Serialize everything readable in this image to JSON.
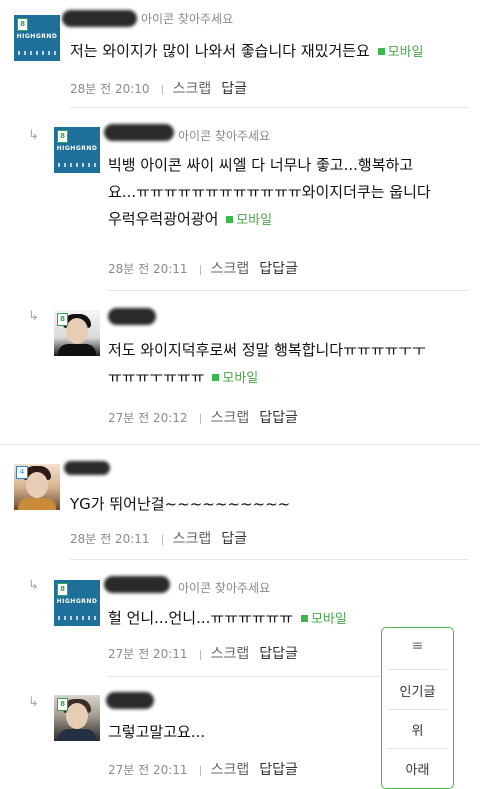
{
  "comments": [
    {
      "hint": "아이콘 찾아주세요",
      "avatar_icon": "group-cover-avatar",
      "body": "저는 와이지가 많이 나와서 좋습니다 재밌거든요",
      "mobile": "모바일",
      "time": "28분 전 20:10",
      "scrap": "스크랩",
      "reply": "답글"
    },
    {
      "hint": "아이콘 찾아주세요",
      "avatar_icon": "group-cover-avatar",
      "body_lines": [
        "빅뱅 아이콘 싸이 씨엘 다 너무나 좋고...행복하고",
        "요...ㅠㅠㅠㅠㅠㅠㅠㅠㅠㅠㅠㅠ와이지더쿠는 웁니다",
        "우럭우럭광어광어"
      ],
      "mobile": "모바일",
      "time": "28분 전 20:11",
      "scrap": "스크랩",
      "reply": "답답글"
    },
    {
      "avatar_icon": "person-avatar",
      "body_lines": [
        "저도 와이지덕후로써 정말 행복합니다ㅠㅠㅠㅠㅜㅜ",
        "ㅠㅠㅠㅜㅠㅠㅠ"
      ],
      "mobile": "모바일",
      "time": "27분 전 20:12",
      "scrap": "스크랩",
      "reply": "답답글"
    },
    {
      "avatar_icon": "person-avatar",
      "level": "4",
      "body": "YG가 뛰어난걸~~~~~~~~~~",
      "time": "28분 전 20:11",
      "scrap": "스크랩",
      "reply": "답글"
    },
    {
      "hint": "아이콘 찾아주세요",
      "avatar_icon": "group-cover-avatar",
      "body": "헐 언니...언니...ㅠㅠㅠㅠㅠㅠ",
      "mobile": "모바일",
      "time": "27분 전 20:11",
      "scrap": "스크랩",
      "reply": "답답글"
    },
    {
      "avatar_icon": "person-avatar",
      "body": "그렇고말고요...",
      "time": "27분 전 20:11",
      "scrap": "스크랩",
      "reply": "답답글"
    }
  ],
  "cover_text": "HIGHGRND",
  "badge_glyph": "8",
  "reply_arrow": "↳",
  "popup": {
    "menu_icon": "≡",
    "popular": "인기글",
    "up": "위",
    "down": "아래"
  },
  "colors": {
    "accent_green": "#3cb84b",
    "border_green": "#4db848"
  }
}
